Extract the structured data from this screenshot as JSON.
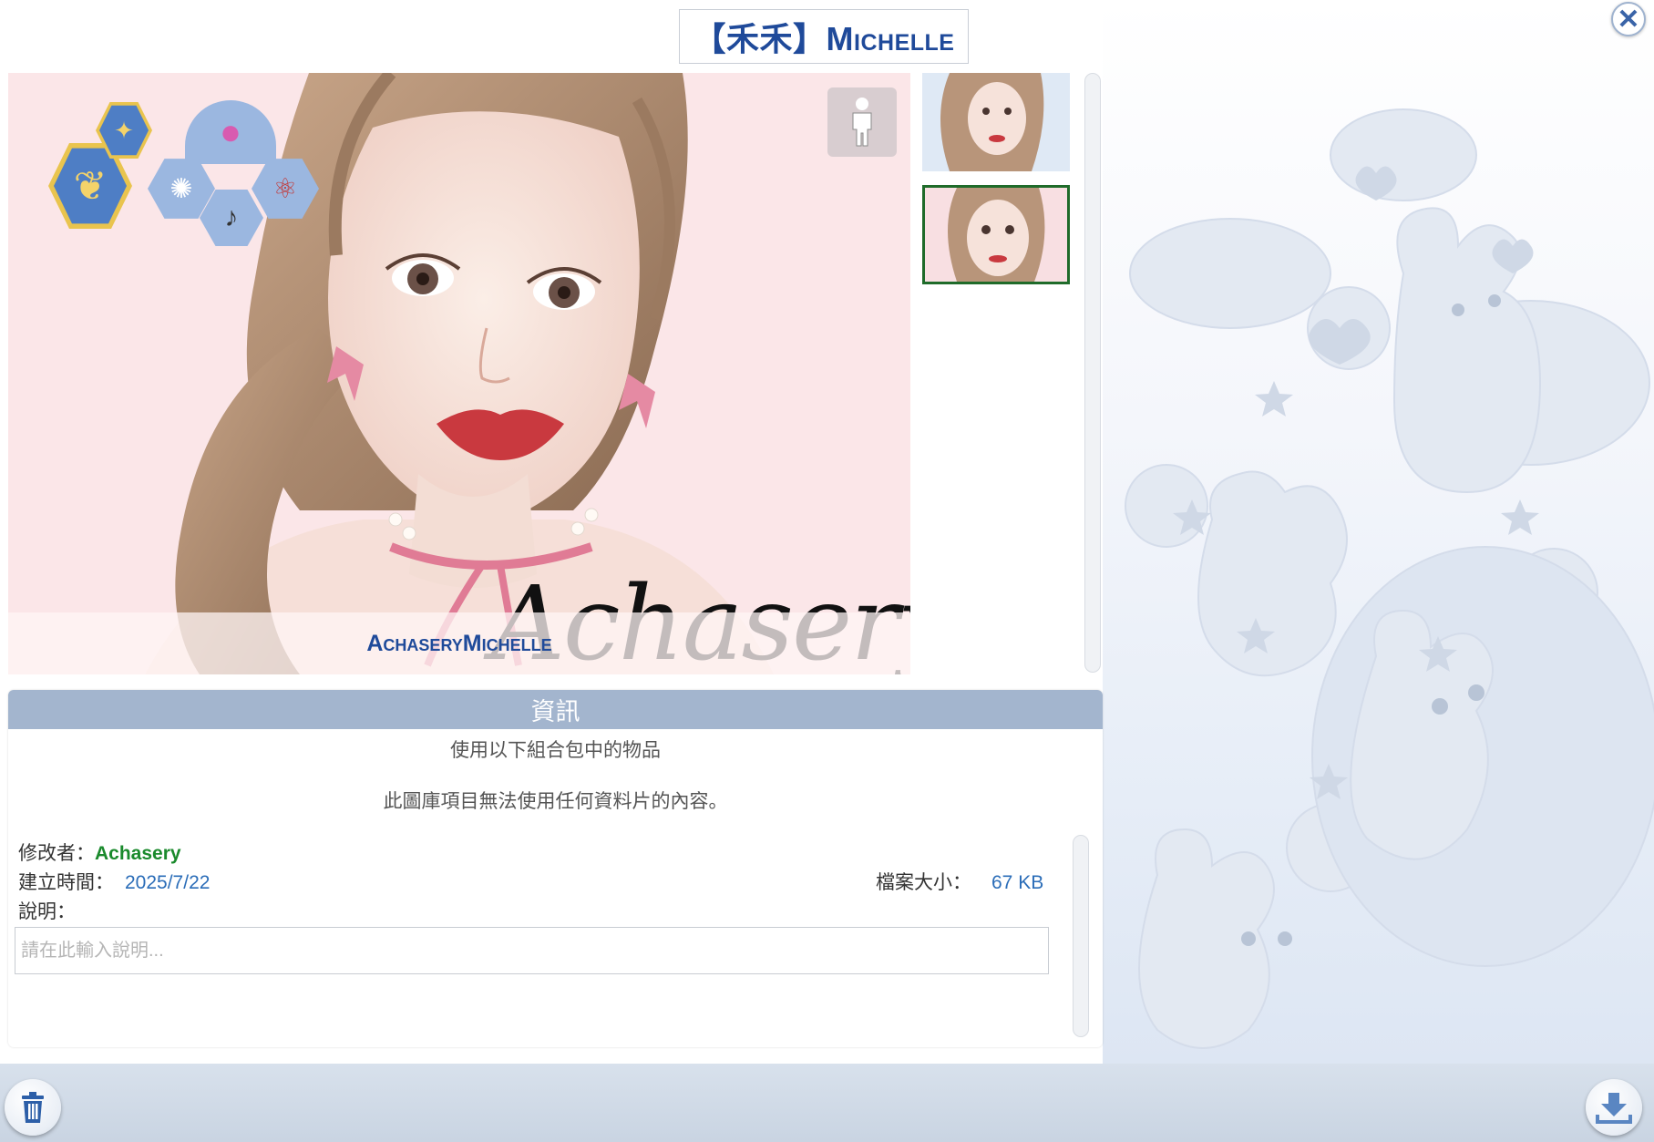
{
  "header": {
    "title": "【禾禾】Michelle"
  },
  "preview": {
    "caption": "AchaseryMichelle",
    "signature": "Achasery"
  },
  "icons": {
    "close": "close-icon",
    "body_toggle": "person-silhouette-icon",
    "delete": "trash-icon",
    "download": "download-icon",
    "aspiration": "butterfly-icon",
    "trait_fairy": "fairy-icon",
    "trait_social": "person-bubble-icon",
    "trait_creative": "lightbulb-icon",
    "trait_music": "music-note-icon",
    "trait_science": "atom-icon"
  },
  "info": {
    "header": "資訊",
    "packs_label": "使用以下組合包中的物品",
    "no_content_message": "此圖庫項目無法使用任何資料片的內容。",
    "creator_label": "修改者：",
    "creator": "Achasery",
    "date_label": "建立時間：",
    "date": "2025/7/22",
    "size_label": "檔案大小：",
    "size": "67 KB",
    "description_label": "說明：",
    "description_placeholder": "請在此輸入說明..."
  },
  "colors": {
    "title_blue": "#1f4a9a",
    "creator_green": "#1a8a2c",
    "value_blue": "#2b6db8",
    "info_header_bg": "#a3b5ce",
    "selected_thumb_border": "#1f6b2a"
  }
}
